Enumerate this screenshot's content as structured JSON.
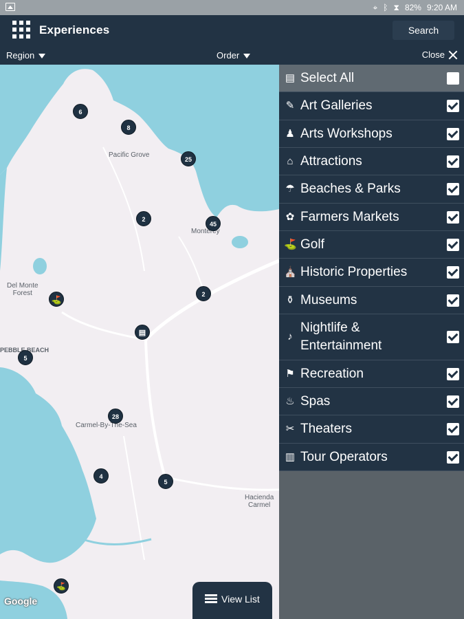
{
  "status_bar": {
    "battery": "82%",
    "time": "9:20 AM"
  },
  "app": {
    "title": "Experiences",
    "search_label": "Search"
  },
  "filters": {
    "region": "Region",
    "order": "Order",
    "close": "Close"
  },
  "map": {
    "labels": {
      "pacific_grove": "Pacific Grove",
      "monterey": "Monterey",
      "del_monte_forest": "Del Monte\nForest",
      "pebble_beach": "PEBBLE BEACH",
      "carmel_by_the_sea": "Carmel-By-The-Sea",
      "hacienda_carmel": "Hacienda\nCarmel",
      "google": "Google"
    },
    "markers": [
      {
        "id": "m1",
        "count": "6"
      },
      {
        "id": "m2",
        "count": "8"
      },
      {
        "id": "m3",
        "count": "25"
      },
      {
        "id": "m4",
        "count": "2"
      },
      {
        "id": "m5",
        "count": "45"
      },
      {
        "id": "m6",
        "count": "2"
      },
      {
        "id": "m7",
        "count": "5"
      },
      {
        "id": "m8",
        "count": "28"
      },
      {
        "id": "m9",
        "count": "4"
      },
      {
        "id": "m10",
        "count": "5"
      }
    ],
    "view_list_label": "View List"
  },
  "categories": {
    "select_all": {
      "label": "Select All",
      "checked": false,
      "icon": "select-all-icon"
    },
    "items": [
      {
        "label": "Art Galleries",
        "checked": true,
        "icon": "palette-icon"
      },
      {
        "label": "Arts Workshops",
        "checked": true,
        "icon": "person-icon"
      },
      {
        "label": "Attractions",
        "checked": true,
        "icon": "landmark-icon"
      },
      {
        "label": "Beaches & Parks",
        "checked": true,
        "icon": "beach-icon"
      },
      {
        "label": "Farmers Markets",
        "checked": true,
        "icon": "produce-icon"
      },
      {
        "label": "Golf",
        "checked": true,
        "icon": "golf-icon"
      },
      {
        "label": "Historic Properties",
        "checked": true,
        "icon": "historic-icon"
      },
      {
        "label": "Museums",
        "checked": true,
        "icon": "museum-icon"
      },
      {
        "label": "Nightlife & Entertainment",
        "checked": true,
        "icon": "nightlife-icon"
      },
      {
        "label": "Recreation",
        "checked": true,
        "icon": "signpost-icon"
      },
      {
        "label": "Spas",
        "checked": true,
        "icon": "spa-icon"
      },
      {
        "label": "Theaters",
        "checked": true,
        "icon": "ticket-icon"
      },
      {
        "label": "Tour Operators",
        "checked": true,
        "icon": "map-book-icon"
      }
    ]
  },
  "colors": {
    "header": "#223344",
    "panel_gray": "#5a6268",
    "water": "#8fd0df",
    "land": "#f2eef2"
  }
}
